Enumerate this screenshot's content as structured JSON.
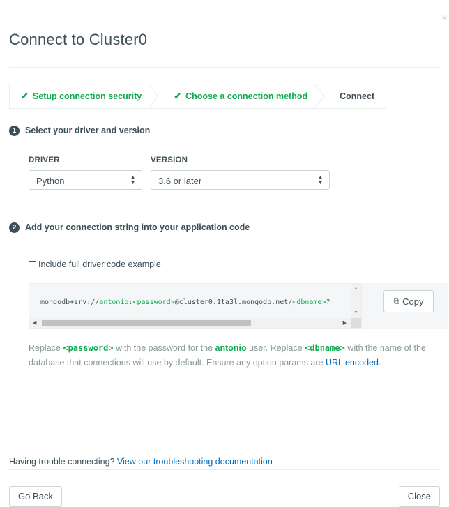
{
  "modal": {
    "title": "Connect to Cluster0",
    "close_icon": "×"
  },
  "steps": [
    {
      "label": "Setup connection security",
      "state": "done"
    },
    {
      "label": "Choose a connection method",
      "state": "done"
    },
    {
      "label": "Connect",
      "state": "current"
    }
  ],
  "section1": {
    "number": "1",
    "title": "Select your driver and version",
    "driver_label": "DRIVER",
    "driver_value": "Python",
    "version_label": "VERSION",
    "version_value": "3.6 or later"
  },
  "section2": {
    "number": "2",
    "title": "Add your connection string into your application code",
    "checkbox_label": "Include full driver code example",
    "checkbox_checked": false,
    "connection_string": {
      "prefix": "mongodb+srv://",
      "user": "antonio",
      "sep": ":",
      "password_ph": "<password>",
      "host": "@cluster0.1ta3l.mongodb.net/",
      "dbname_ph": "<dbname>",
      "suffix": "?"
    },
    "copy_label": "Copy"
  },
  "note": {
    "t1": "Replace ",
    "password_code": "<password>",
    "t2": " with the password for the ",
    "user": "antonio",
    "t3": " user. Replace ",
    "dbname_code": "<dbname>",
    "t4": " with the name of the database that connections will use by default. Ensure any option params are ",
    "link": "URL encoded",
    "t5": "."
  },
  "trouble": {
    "text": "Having trouble connecting? ",
    "link": "View our troubleshooting documentation"
  },
  "footer": {
    "back_label": "Go Back",
    "close_label": "Close"
  },
  "colors": {
    "accent_green": "#13aa52",
    "link_blue": "#006cbc",
    "text_dark": "#3d4f58"
  }
}
